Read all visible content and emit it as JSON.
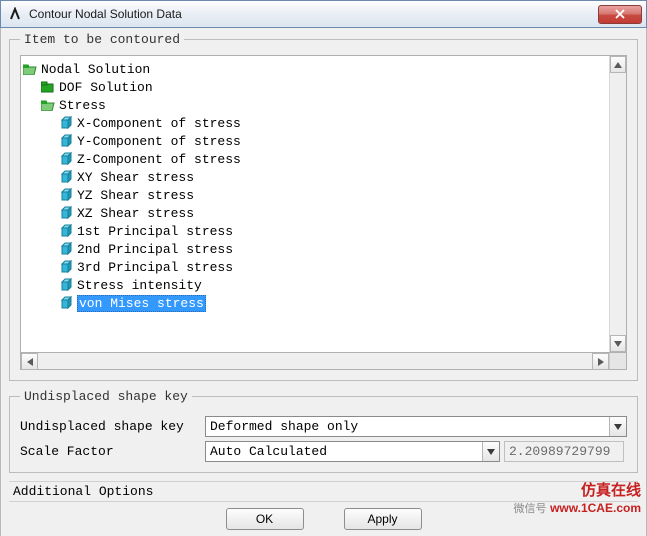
{
  "window": {
    "title": "Contour Nodal Solution Data"
  },
  "group1": {
    "legend": "Item to be contoured",
    "tree": {
      "root": "Nodal Solution",
      "dof": "DOF Solution",
      "stress": "Stress",
      "items": [
        "X-Component of stress",
        "Y-Component of stress",
        "Z-Component of stress",
        "XY Shear stress",
        "YZ Shear stress",
        "XZ Shear stress",
        "1st Principal stress",
        "2nd Principal stress",
        "3rd Principal stress",
        "Stress intensity",
        "von Mises stress"
      ],
      "selected_index": 10
    }
  },
  "group2": {
    "legend": "Undisplaced shape key",
    "shape_label": "Undisplaced shape key",
    "shape_value": "Deformed shape only",
    "scale_label": "Scale Factor",
    "scale_value": "Auto Calculated",
    "scale_number": "2.20989729799"
  },
  "group3": {
    "label": "Additional Options"
  },
  "buttons": {
    "ok": "OK",
    "apply": "Apply"
  },
  "watermark": {
    "cn": "仿真在线",
    "wx": "微信号",
    "url": "www.1CAE.com"
  }
}
